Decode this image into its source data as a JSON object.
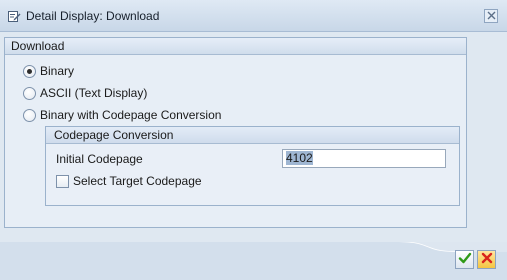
{
  "window": {
    "title": "Detail Display: Download",
    "title_icon": "edit-document-icon",
    "close_icon": "close-icon"
  },
  "download_group": {
    "title": "Download",
    "options": [
      {
        "label": "Binary",
        "selected": true
      },
      {
        "label": "ASCII (Text Display)",
        "selected": false
      },
      {
        "label": "Binary with Codepage Conversion",
        "selected": false
      }
    ]
  },
  "codepage_group": {
    "title": "Codepage Conversion",
    "initial_codepage_label": "Initial Codepage",
    "initial_codepage_value": "4102",
    "select_target_label": "Select Target Codepage",
    "select_target_checked": false
  },
  "footer": {
    "confirm_icon": "checkmark-icon",
    "cancel_icon": "cancel-x-icon"
  },
  "colors": {
    "confirm_green": "#2f9a18",
    "cancel_red": "#d8241c",
    "cancel_bg": "#f4c542"
  }
}
